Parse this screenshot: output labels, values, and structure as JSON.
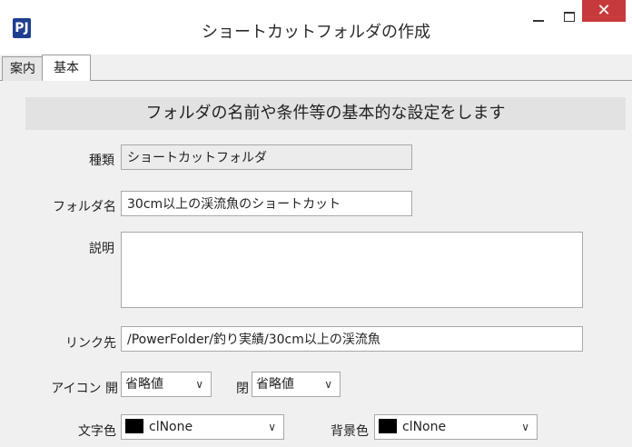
{
  "window": {
    "icon_text": "PJ",
    "title": "ショートカットフォルダの作成",
    "close_glyph": "✕"
  },
  "tabs": [
    {
      "label": "案内",
      "active": false
    },
    {
      "label": "基本",
      "active": true
    }
  ],
  "heading": "フォルダの名前や条件等の基本的な設定をします",
  "form": {
    "type_label": "種類",
    "type_value": "ショートカットフォルダ",
    "folder_name_label": "フォルダ名",
    "folder_name_value": "30cm以上の渓流魚のショートカット",
    "description_label": "説明",
    "description_value": "",
    "link_label": "リンク先",
    "link_value": "/PowerFolder/釣り実績/30cm以上の渓流魚",
    "icon_open_label": "アイコン 開",
    "icon_open_value": "省略値",
    "icon_closed_label": "閉",
    "icon_closed_value": "省略値",
    "text_color_label": "文字色",
    "text_color_value": "clNone",
    "bg_color_label": "背景色",
    "bg_color_value": "clNone"
  },
  "colors": {
    "close_button": "#c73a3b",
    "swatch": "#000000"
  }
}
